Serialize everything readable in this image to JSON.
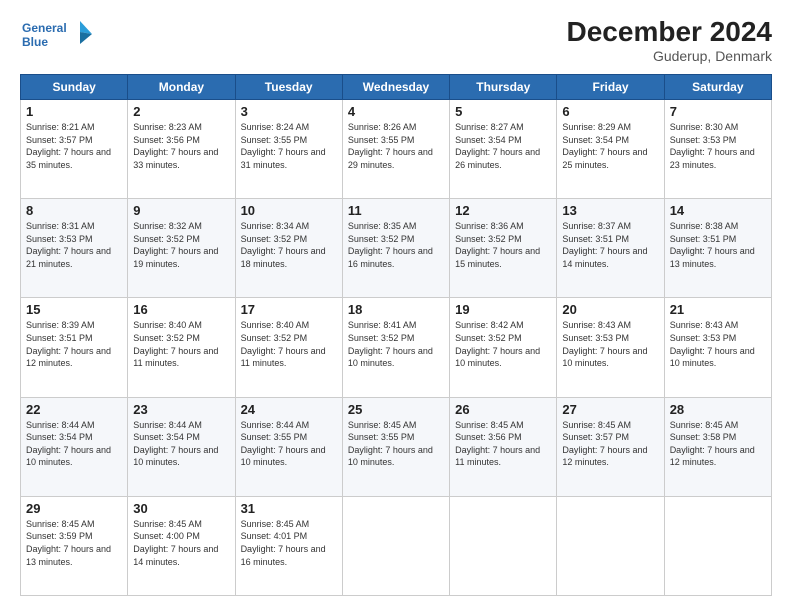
{
  "logo": {
    "line1": "General",
    "line2": "Blue"
  },
  "title": "December 2024",
  "subtitle": "Guderup, Denmark",
  "days_header": [
    "Sunday",
    "Monday",
    "Tuesday",
    "Wednesday",
    "Thursday",
    "Friday",
    "Saturday"
  ],
  "weeks": [
    [
      {
        "day": "1",
        "sunrise": "8:21 AM",
        "sunset": "3:57 PM",
        "daylight": "7 hours and 35 minutes."
      },
      {
        "day": "2",
        "sunrise": "8:23 AM",
        "sunset": "3:56 PM",
        "daylight": "7 hours and 33 minutes."
      },
      {
        "day": "3",
        "sunrise": "8:24 AM",
        "sunset": "3:55 PM",
        "daylight": "7 hours and 31 minutes."
      },
      {
        "day": "4",
        "sunrise": "8:26 AM",
        "sunset": "3:55 PM",
        "daylight": "7 hours and 29 minutes."
      },
      {
        "day": "5",
        "sunrise": "8:27 AM",
        "sunset": "3:54 PM",
        "daylight": "7 hours and 26 minutes."
      },
      {
        "day": "6",
        "sunrise": "8:29 AM",
        "sunset": "3:54 PM",
        "daylight": "7 hours and 25 minutes."
      },
      {
        "day": "7",
        "sunrise": "8:30 AM",
        "sunset": "3:53 PM",
        "daylight": "7 hours and 23 minutes."
      }
    ],
    [
      {
        "day": "8",
        "sunrise": "8:31 AM",
        "sunset": "3:53 PM",
        "daylight": "7 hours and 21 minutes."
      },
      {
        "day": "9",
        "sunrise": "8:32 AM",
        "sunset": "3:52 PM",
        "daylight": "7 hours and 19 minutes."
      },
      {
        "day": "10",
        "sunrise": "8:34 AM",
        "sunset": "3:52 PM",
        "daylight": "7 hours and 18 minutes."
      },
      {
        "day": "11",
        "sunrise": "8:35 AM",
        "sunset": "3:52 PM",
        "daylight": "7 hours and 16 minutes."
      },
      {
        "day": "12",
        "sunrise": "8:36 AM",
        "sunset": "3:52 PM",
        "daylight": "7 hours and 15 minutes."
      },
      {
        "day": "13",
        "sunrise": "8:37 AM",
        "sunset": "3:51 PM",
        "daylight": "7 hours and 14 minutes."
      },
      {
        "day": "14",
        "sunrise": "8:38 AM",
        "sunset": "3:51 PM",
        "daylight": "7 hours and 13 minutes."
      }
    ],
    [
      {
        "day": "15",
        "sunrise": "8:39 AM",
        "sunset": "3:51 PM",
        "daylight": "7 hours and 12 minutes."
      },
      {
        "day": "16",
        "sunrise": "8:40 AM",
        "sunset": "3:52 PM",
        "daylight": "7 hours and 11 minutes."
      },
      {
        "day": "17",
        "sunrise": "8:40 AM",
        "sunset": "3:52 PM",
        "daylight": "7 hours and 11 minutes."
      },
      {
        "day": "18",
        "sunrise": "8:41 AM",
        "sunset": "3:52 PM",
        "daylight": "7 hours and 10 minutes."
      },
      {
        "day": "19",
        "sunrise": "8:42 AM",
        "sunset": "3:52 PM",
        "daylight": "7 hours and 10 minutes."
      },
      {
        "day": "20",
        "sunrise": "8:43 AM",
        "sunset": "3:53 PM",
        "daylight": "7 hours and 10 minutes."
      },
      {
        "day": "21",
        "sunrise": "8:43 AM",
        "sunset": "3:53 PM",
        "daylight": "7 hours and 10 minutes."
      }
    ],
    [
      {
        "day": "22",
        "sunrise": "8:44 AM",
        "sunset": "3:54 PM",
        "daylight": "7 hours and 10 minutes."
      },
      {
        "day": "23",
        "sunrise": "8:44 AM",
        "sunset": "3:54 PM",
        "daylight": "7 hours and 10 minutes."
      },
      {
        "day": "24",
        "sunrise": "8:44 AM",
        "sunset": "3:55 PM",
        "daylight": "7 hours and 10 minutes."
      },
      {
        "day": "25",
        "sunrise": "8:45 AM",
        "sunset": "3:55 PM",
        "daylight": "7 hours and 10 minutes."
      },
      {
        "day": "26",
        "sunrise": "8:45 AM",
        "sunset": "3:56 PM",
        "daylight": "7 hours and 11 minutes."
      },
      {
        "day": "27",
        "sunrise": "8:45 AM",
        "sunset": "3:57 PM",
        "daylight": "7 hours and 12 minutes."
      },
      {
        "day": "28",
        "sunrise": "8:45 AM",
        "sunset": "3:58 PM",
        "daylight": "7 hours and 12 minutes."
      }
    ],
    [
      {
        "day": "29",
        "sunrise": "8:45 AM",
        "sunset": "3:59 PM",
        "daylight": "7 hours and 13 minutes."
      },
      {
        "day": "30",
        "sunrise": "8:45 AM",
        "sunset": "4:00 PM",
        "daylight": "7 hours and 14 minutes."
      },
      {
        "day": "31",
        "sunrise": "8:45 AM",
        "sunset": "4:01 PM",
        "daylight": "7 hours and 16 minutes."
      },
      null,
      null,
      null,
      null
    ]
  ],
  "labels": {
    "sunrise": "Sunrise:",
    "sunset": "Sunset:",
    "daylight": "Daylight:"
  }
}
